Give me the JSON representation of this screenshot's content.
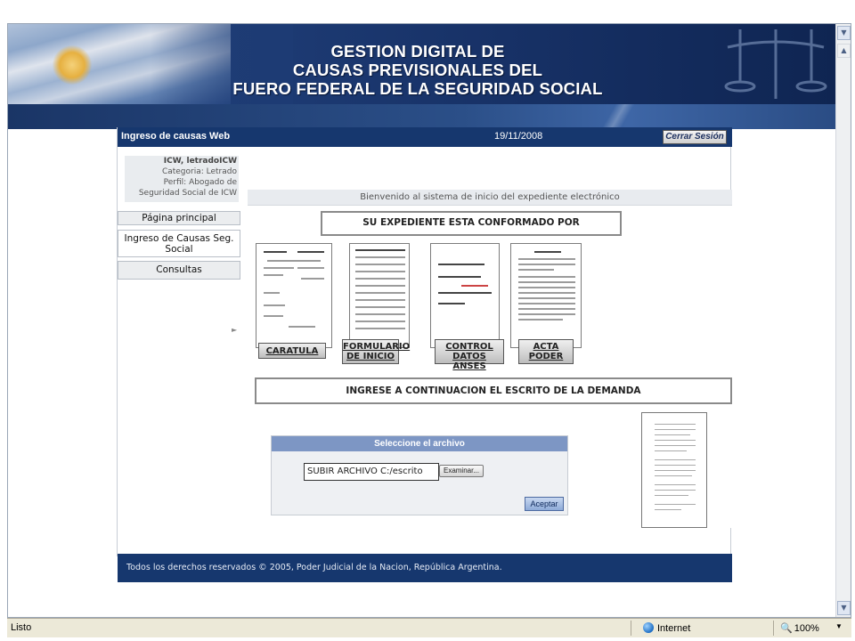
{
  "banner": {
    "title_line1": "GESTION DIGITAL DE",
    "title_line2": "CAUSAS PREVISIONALES DEL",
    "title_line3": "FUERO FEDERAL DE LA SEGURIDAD SOCIAL"
  },
  "header": {
    "app_title": "Ingreso de causas Web",
    "date": "19/11/2008",
    "logout_label": "Cerrar Sesión"
  },
  "user": {
    "name": "ICW, letradoICW",
    "category": "Categoria: Letrado",
    "profile": "Perfil: Abogado de",
    "profile_cont": "Seguridad Social de ICW"
  },
  "sidebar": {
    "items": [
      {
        "label": "Página principal"
      },
      {
        "label_line1": "Ingreso de Causas Seg.",
        "label_line2": "Social"
      },
      {
        "label": "Consultas"
      }
    ]
  },
  "content": {
    "welcome": "Bienvenido al sistema de inicio del expediente electrónico",
    "section1_title": "SU EXPEDIENTE ESTA CONFORMADO  POR",
    "documents": [
      {
        "label": "CARATULA"
      },
      {
        "label_line1": "FORMULARIO",
        "label_line2": "DE INICIO"
      },
      {
        "label_line1": "CONTROL",
        "label_line2": "DATOS ANSES"
      },
      {
        "label_line1": "ACTA",
        "label_line2": "PODER"
      }
    ],
    "section2_title": "INGRESE A CONTINUACION  EL ESCRITO  DE LA DEMANDA"
  },
  "upload": {
    "panel_title": "Seleccione el archivo",
    "file_value": "SUBIR ARCHIVO C:/escrito",
    "browse_label": "Examinar...",
    "accept_label": "Aceptar"
  },
  "footer": {
    "text": "Todos los derechos reservados © 2005, Poder Judicial de la Nacion, República Argentina."
  },
  "statusbar": {
    "status": "Listo",
    "zone": "Internet",
    "zoom": "100%"
  }
}
